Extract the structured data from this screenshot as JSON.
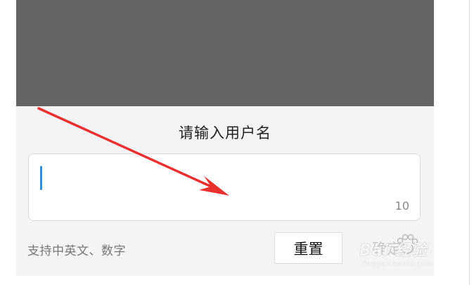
{
  "dialog": {
    "title": "请输入用户名",
    "input": {
      "value": "",
      "placeholder": "",
      "max_length": "10"
    },
    "hint": "支持中英文、数字",
    "buttons": {
      "reset_label": "重置",
      "confirm_label": "确定"
    }
  },
  "watermark": {
    "brand": "Bai 经验",
    "url": "jingyan.baidu.com"
  },
  "colors": {
    "overlay": "#646464",
    "dialog_bg": "#f4f4f6",
    "caret": "#2f8ed6",
    "annotation_arrow": "#e8312f",
    "confirm_disabled": "#c9c9c9"
  }
}
